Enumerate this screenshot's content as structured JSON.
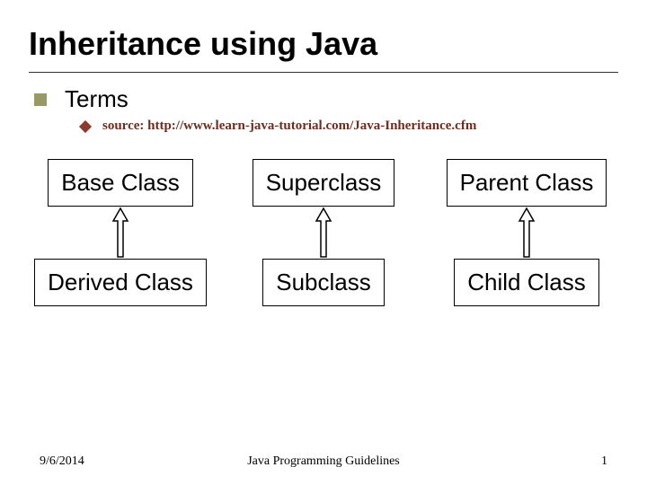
{
  "title": "Inheritance using Java",
  "bullet": {
    "terms": "Terms",
    "source": "source: http://www.learn-java-tutorial.com/Java-Inheritance.cfm"
  },
  "diagram": {
    "pairs": [
      {
        "top": "Base Class",
        "bottom": "Derived Class"
      },
      {
        "top": "Superclass",
        "bottom": "Subclass"
      },
      {
        "top": "Parent Class",
        "bottom": "Child Class"
      }
    ]
  },
  "footer": {
    "date": "9/6/2014",
    "center": "Java Programming Guidelines",
    "page": "1"
  }
}
